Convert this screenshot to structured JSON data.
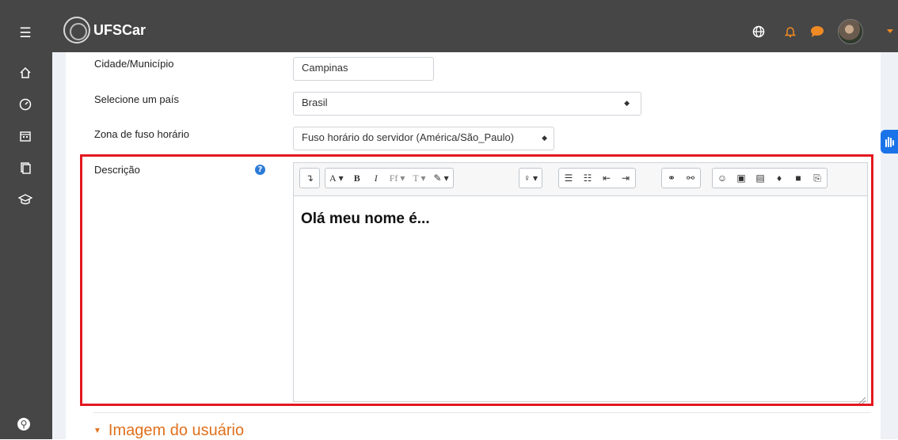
{
  "header": {
    "brand": "UFSCar",
    "icons": [
      "menu-icon",
      "globe-icon",
      "bell-icon",
      "chat-icon",
      "avatar",
      "chevron-down-icon"
    ]
  },
  "sidebar": {
    "items": [
      "home-icon",
      "dashboard-icon",
      "calendar-icon",
      "files-icon",
      "graduation-cap-icon"
    ],
    "bottom": "accessibility-icon"
  },
  "form": {
    "city_label": "Cidade/Município",
    "city_value": "Campinas",
    "country_label": "Selecione um país",
    "country_value": "Brasil",
    "timezone_label": "Zona de fuso horário",
    "timezone_value": "Fuso horário do servidor (América/São_Paulo)",
    "description_label": "Descrição",
    "description_help": "?",
    "description_text": "Olá meu nome é..."
  },
  "toolbar": {
    "buttons": [
      "collapse-icon",
      "font-color-icon",
      "bold-icon",
      "italic-icon",
      "font-family-icon",
      "font-size-icon",
      "brush-icon",
      "lightbulb-icon",
      "bullet-list-icon",
      "numbered-list-icon",
      "outdent-icon",
      "indent-icon",
      "link-icon",
      "unlink-icon",
      "emoji-icon",
      "image-icon",
      "media-icon",
      "audio-record-icon",
      "video-record-icon",
      "copy-icon"
    ],
    "bold": "B",
    "italic": "I",
    "font_letter": "A"
  },
  "section": {
    "title": "Imagem do usuário"
  },
  "colors": {
    "topbar": "#464646",
    "accent_orange": "#e0701d",
    "highlight_red": "#e3181f",
    "help_blue": "#2b7bd8"
  }
}
